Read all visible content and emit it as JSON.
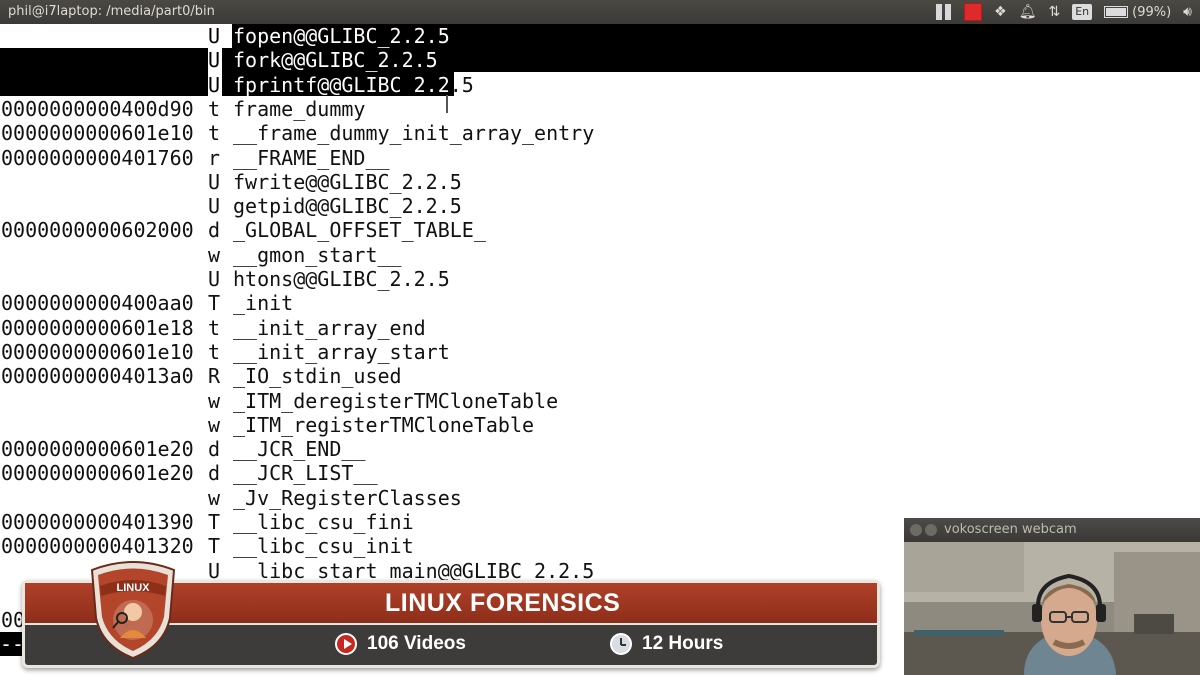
{
  "window": {
    "title": "phil@i7laptop: /media/part0/bin"
  },
  "tray": {
    "keyboard_layout": "En",
    "battery_label": "(99%)",
    "battery_level": 0.99,
    "icons": [
      "pause-icon",
      "stop-record-icon",
      "dropbox-icon",
      "notification-bell-icon",
      "network-arrows-icon",
      "keyboard-layout-icon",
      "battery-icon",
      "volume-icon"
    ]
  },
  "terminal": {
    "rows": [
      {
        "addr": "",
        "type": "U",
        "symbol": "fopen@@GLIBC_2.2.5"
      },
      {
        "addr": "",
        "type": "U",
        "symbol": "fork@@GLIBC_2.2.5"
      },
      {
        "addr": "",
        "type": "U",
        "symbol": "fprintf@@GLIBC_2.2.5"
      },
      {
        "addr": "0000000000400d90",
        "type": "t",
        "symbol": "frame_dummy"
      },
      {
        "addr": "0000000000601e10",
        "type": "t",
        "symbol": "__frame_dummy_init_array_entry"
      },
      {
        "addr": "0000000000401760",
        "type": "r",
        "symbol": "__FRAME_END__"
      },
      {
        "addr": "",
        "type": "U",
        "symbol": "fwrite@@GLIBC_2.2.5"
      },
      {
        "addr": "",
        "type": "U",
        "symbol": "getpid@@GLIBC_2.2.5"
      },
      {
        "addr": "0000000000602000",
        "type": "d",
        "symbol": "_GLOBAL_OFFSET_TABLE_"
      },
      {
        "addr": "",
        "type": "w",
        "symbol": "__gmon_start__"
      },
      {
        "addr": "",
        "type": "U",
        "symbol": "htons@@GLIBC_2.2.5"
      },
      {
        "addr": "0000000000400aa0",
        "type": "T",
        "symbol": "_init"
      },
      {
        "addr": "0000000000601e18",
        "type": "t",
        "symbol": "__init_array_end"
      },
      {
        "addr": "0000000000601e10",
        "type": "t",
        "symbol": "__init_array_start"
      },
      {
        "addr": "00000000004013a0",
        "type": "R",
        "symbol": "_IO_stdin_used"
      },
      {
        "addr": "",
        "type": "w",
        "symbol": "_ITM_deregisterTMCloneTable"
      },
      {
        "addr": "",
        "type": "w",
        "symbol": "_ITM_registerTMCloneTable"
      },
      {
        "addr": "0000000000601e20",
        "type": "d",
        "symbol": "__JCR_END__"
      },
      {
        "addr": "0000000000601e20",
        "type": "d",
        "symbol": "__JCR_LIST__"
      },
      {
        "addr": "",
        "type": "w",
        "symbol": "_Jv_RegisterClasses"
      },
      {
        "addr": "0000000000401390",
        "type": "T",
        "symbol": "__libc_csu_fini"
      },
      {
        "addr": "0000000000401320",
        "type": "T",
        "symbol": "__libc_csu_init"
      },
      {
        "addr": "",
        "type": "U",
        "symbol": "__libc_start_main@@GLIBC_2.2.5"
      }
    ],
    "partial_row_fragment": "00",
    "partial_prompt_fragment": "--"
  },
  "banner": {
    "title": "LINUX FORENSICS",
    "badge_text": "LINUX",
    "videos_label": "106 Videos",
    "hours_label": "12 Hours",
    "accent_color": "#a8381f"
  },
  "webcam": {
    "title": "vokoscreen webcam"
  }
}
